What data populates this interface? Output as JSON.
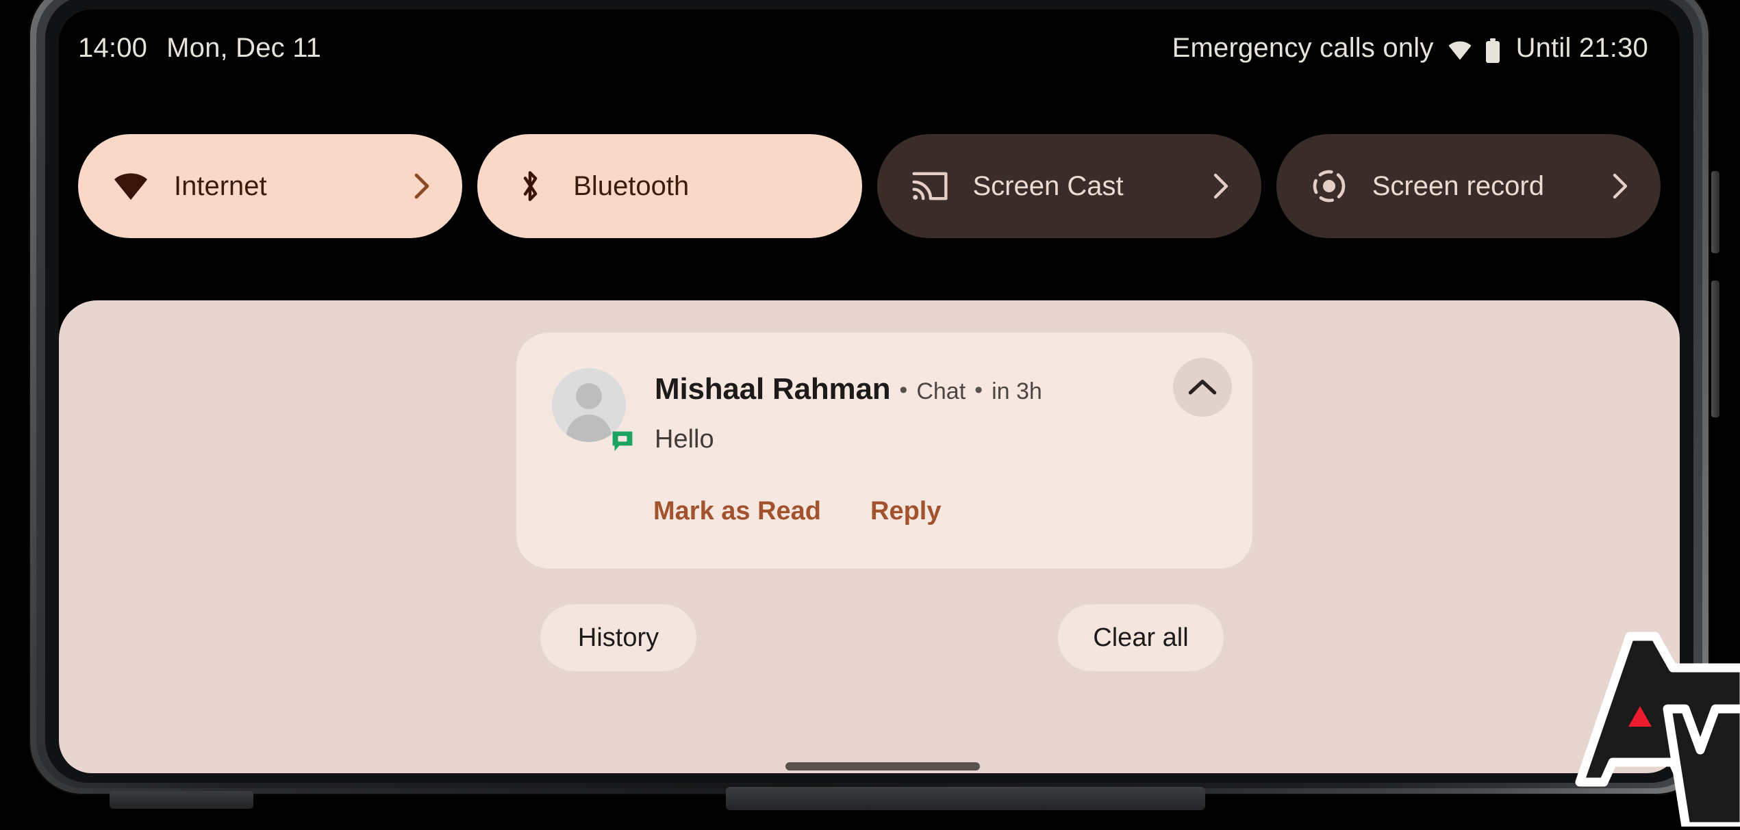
{
  "device": {
    "name": "android-phone",
    "shell": "Pixel-style phone with notification shade pulled down"
  },
  "status_bar": {
    "time": "14:00",
    "date": "Mon, Dec 11",
    "carrier": "Emergency calls only",
    "wifi_icon": "wifi-icon",
    "battery_icon": "battery-icon",
    "battery_estimate": "Until 21:30"
  },
  "quick_settings": {
    "tiles": [
      {
        "label": "Internet",
        "icon": "wifi-icon",
        "state": "active",
        "has_chevron": true,
        "name": "internet"
      },
      {
        "label": "Bluetooth",
        "icon": "bluetooth-icon",
        "state": "active",
        "has_chevron": false,
        "name": "bluetooth"
      },
      {
        "label": "Screen Cast",
        "icon": "cast-icon",
        "state": "inactive",
        "has_chevron": true,
        "name": "screen-cast"
      },
      {
        "label": "Screen record",
        "icon": "screen-record-icon",
        "state": "inactive",
        "has_chevron": true,
        "name": "screen-record"
      }
    ]
  },
  "notification": {
    "app_badge_icon": "messages-icon",
    "avatar_icon": "person-avatar-icon",
    "sender": "Mishaal Rahman",
    "separator": "•",
    "channel": "Chat",
    "time": "in 3h",
    "message": "Hello",
    "actions": [
      {
        "label": "Mark as Read",
        "name": "mark-as-read"
      },
      {
        "label": "Reply",
        "name": "reply"
      }
    ],
    "collapse_icon": "chevron-up-icon"
  },
  "shade_footer": {
    "history_label": "History",
    "clear_all_label": "Clear all"
  },
  "navigation": {
    "home_gesture_bar": "home-gesture-bar"
  },
  "watermark": {
    "name": "android-police-logo",
    "accent_color": "#ed1c2e"
  },
  "colors": {
    "screen_background": "#000000",
    "shade_background": "#e7d6cf",
    "notification_card": "#f7e7e1",
    "tile_active_bg": "#fad8c8",
    "tile_active_fg": "#3a1c0e",
    "tile_inactive_bg": "#3a2d29",
    "tile_inactive_fg": "#ecdad3",
    "action_text": "#a2532e",
    "status_text": "#e6e3dd",
    "home_bar": "#5a504d",
    "messages_badge": "#1da462"
  }
}
